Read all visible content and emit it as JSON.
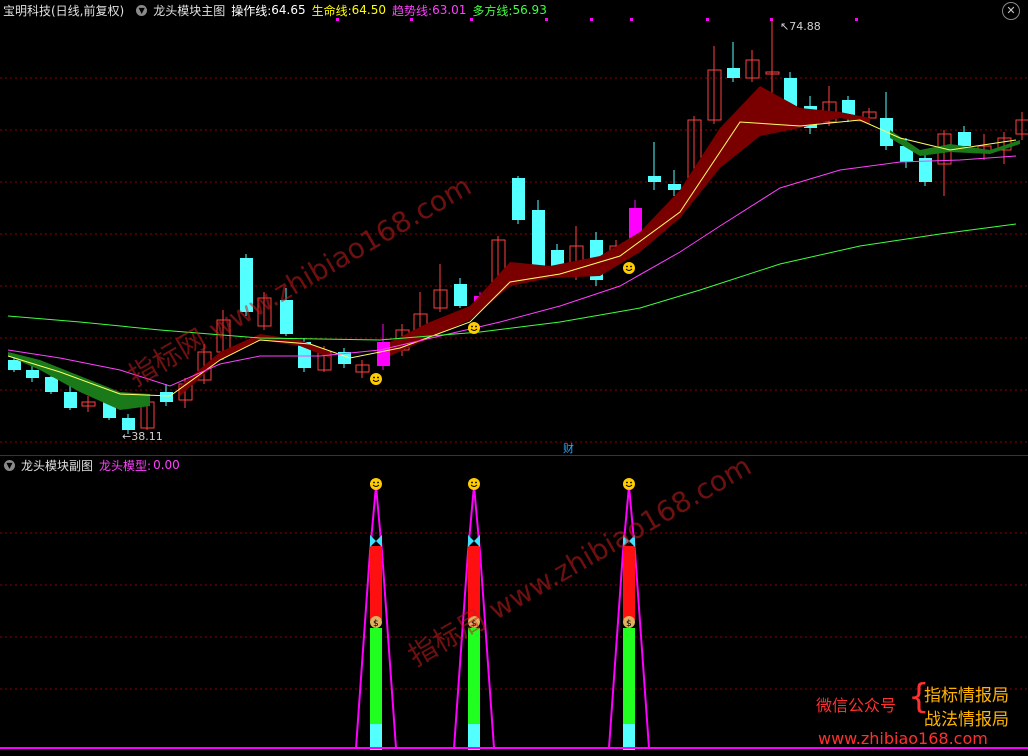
{
  "main_header": {
    "security": "宝明科技(日线,前复权)",
    "indicator_name": "龙头模块主图",
    "op_label": "操作线:",
    "op_value": "64.65",
    "life_label": "生命线:",
    "life_value": "64.50",
    "trend_label": "趋势线:",
    "trend_value": "63.01",
    "bull_label": "多方线:",
    "bull_value": "56.93",
    "high_marker": "74.88",
    "low_marker": "38.11",
    "finance_tag": "财"
  },
  "sub_header": {
    "indicator_name": "龙头模块副图",
    "model_label": "龙头模型:",
    "model_value": "0.00"
  },
  "watermarks": [
    "指标网 www.zhibiao168.com",
    "指标局 www.zhibiao168.com"
  ],
  "ad": {
    "wechat": "微信公众号",
    "line1": "指标情报局",
    "line2": "战法情报局",
    "url": "www.zhibiao168.com"
  },
  "colors": {
    "bg": "#000000",
    "up": "#ff4040",
    "down": "#54ffff",
    "signal": "#ff00ff",
    "op_line": "#ffff00",
    "life_line": "#ffff66",
    "trend_line": "#ff40ff",
    "bull_line": "#40ff40",
    "ribbon_red": "#7a0000",
    "ribbon_green": "#1a7a1a",
    "grid": "#8b0000"
  },
  "icons": [
    "close-icon",
    "chevron-down-icon",
    "smiley-icon",
    "butterfly-icon",
    "money-bag-icon"
  ]
}
